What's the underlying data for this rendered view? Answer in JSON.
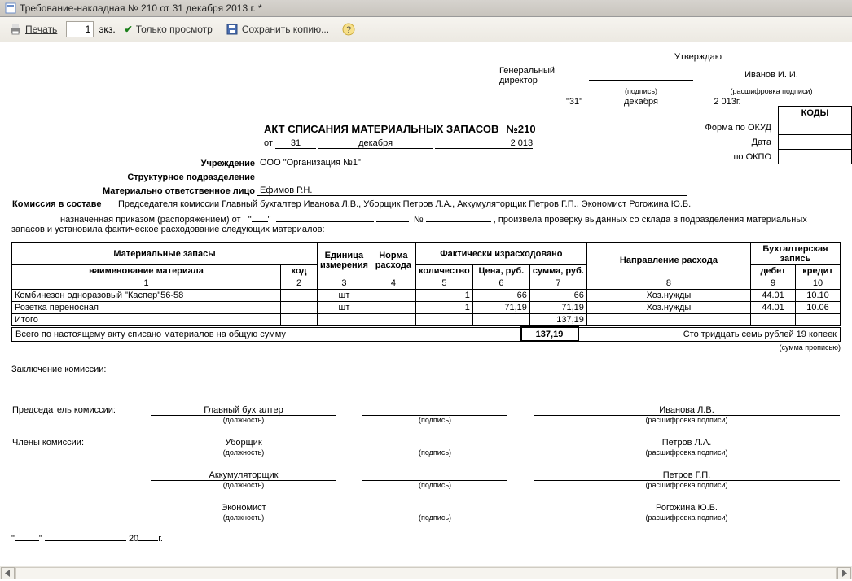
{
  "window": {
    "title": "Требование-накладная № 210 от 31 декабря 2013 г. *"
  },
  "toolbar": {
    "print": "Печать",
    "copies": "1",
    "copies_suffix": "экз.",
    "view_only": "Только просмотр",
    "save_copy": "Сохранить копию...",
    "help": "?"
  },
  "approve": {
    "caption": "Утверждаю",
    "post_lbl": "Генеральный директор",
    "sign_sub": "(подпись)",
    "name": "Иванов И. И.",
    "name_sub": "(расшифровка подписи)",
    "day": "\"31\"",
    "month": "декабря",
    "year": "2 013г."
  },
  "act": {
    "title": "АКТ СПИСАНИЯ МАТЕРИАЛЬНЫХ ЗАПАСОВ",
    "no_lbl": "№",
    "no": "210",
    "date_from": "от",
    "day": "31",
    "month": "декабря",
    "year": "2 013",
    "okud_lbl": "Форма по ОКУД",
    "date_lbl": "Дата",
    "okpo_lbl": "по ОКПО",
    "codes_hdr": "КОДЫ"
  },
  "org": {
    "org_lbl": "Учреждение",
    "org": "ООО \"Организация №1\"",
    "dept_lbl": "Структурное подразделение",
    "mol_lbl": "Материально ответственное лицо",
    "mol": "Ефимов Р.Н.",
    "comm_lbl": "Комиссия в составе",
    "comm_text": "Председателя комиссии Главный бухгалтер Иванова Л.В., Уборщик Петров Л.А., Аккумуляторщик Петров Г.П., Экономист Рогожина Ю.Б.",
    "order_lbl": "назначенная приказом (распоряжением) от",
    "order_no_lbl": "№",
    "order_tail": ", произвела проверку выданных со склада в подразделения материальных запасов и установила фактическое расходование следующих материалов:"
  },
  "tbl": {
    "h_materials": "Материальные запасы",
    "h_name": "наименование материала",
    "h_code": "код",
    "h_unit": "Единица измерения",
    "h_norm": "Норма расхода",
    "h_fact": "Фактически израсходовано",
    "h_qty": "количество",
    "h_price": "Цена, руб.",
    "h_sum": "сумма, руб.",
    "h_dir": "Направление расхода",
    "h_acc": "Бухгалтерская запись",
    "h_debit": "дебет",
    "h_credit": "кредит",
    "n1": "1",
    "n2": "2",
    "n3": "3",
    "n4": "4",
    "n5": "5",
    "n6": "6",
    "n7": "7",
    "n8": "8",
    "n9": "9",
    "n10": "10",
    "rows": [
      {
        "name": "Комбинезон одноразовый \"Каспер\"56-58",
        "code": "",
        "unit": "шт",
        "norm": "",
        "qty": "1",
        "price": "66",
        "sum": "66",
        "dir": "Хоз.нужды",
        "debit": "44.01",
        "credit": "10.10"
      },
      {
        "name": "Розетка переносная",
        "code": "",
        "unit": "шт",
        "norm": "",
        "qty": "1",
        "price": "71,19",
        "sum": "71,19",
        "dir": "Хоз.нужды",
        "debit": "44.01",
        "credit": "10.06"
      }
    ],
    "total_lbl": "Итого",
    "total_sum": "137,19"
  },
  "totals": {
    "written_lbl": "Всего по настоящему акту списано материалов на общую сумму",
    "amount": "137,19",
    "words": "Сто тридцать семь рублей 19 копеек",
    "words_sub": "(сумма прописью)"
  },
  "conclusion_lbl": "Заключение комиссии:",
  "sig": {
    "chair_lbl": "Председатель комиссии:",
    "members_lbl": "Члены комиссии:",
    "post_sub": "(должность)",
    "sign_sub": "(подпись)",
    "name_sub": "(расшифровка подписи)",
    "rows": [
      {
        "post": "Главный бухгалтер",
        "name": "Иванова Л.В."
      },
      {
        "post": "Уборщик",
        "name": "Петров Л.А."
      },
      {
        "post": "Аккумуляторщик",
        "name": "Петров Г.П."
      },
      {
        "post": "Экономист",
        "name": "Рогожина Ю.Б."
      }
    ]
  },
  "footer_date": {
    "y_suffix": "г.",
    "y_prefix": "20"
  }
}
